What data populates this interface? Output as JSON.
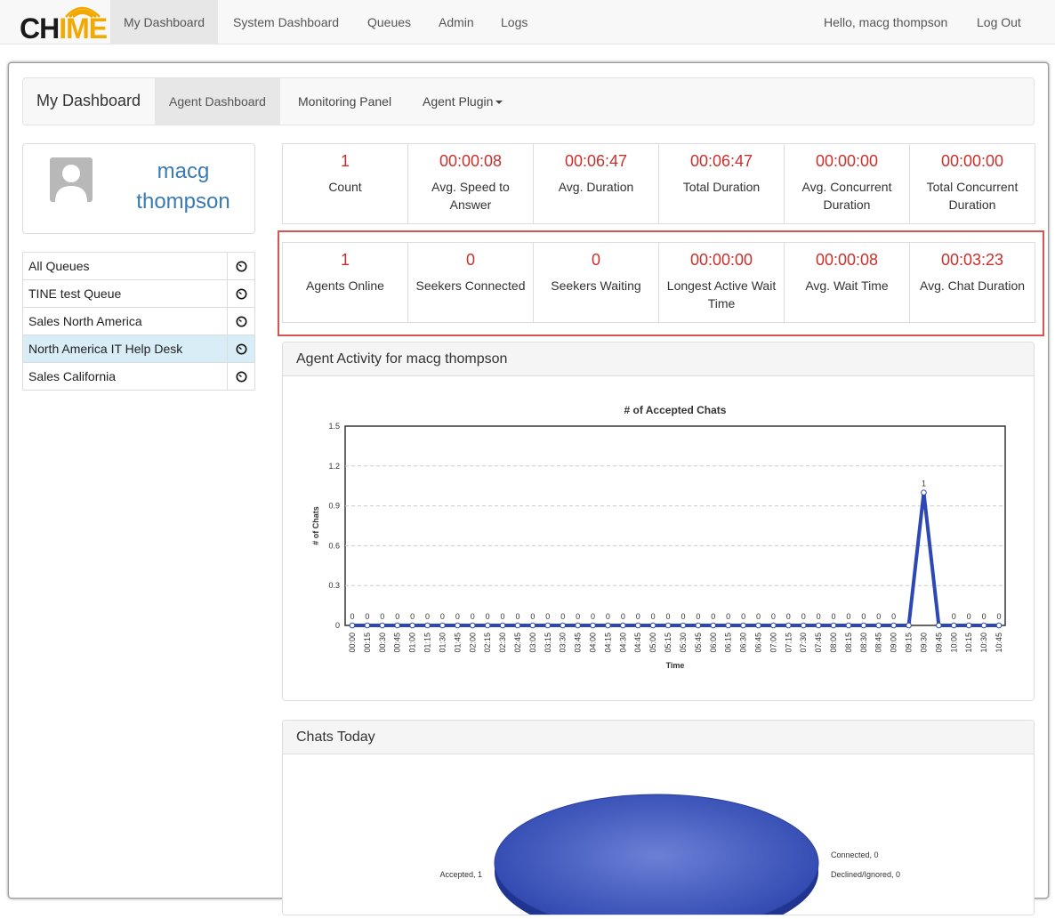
{
  "topnav": {
    "logo": {
      "dark": "CH",
      "accent": "ME",
      "i": "I"
    },
    "items": [
      "My Dashboard",
      "System Dashboard",
      "Queues",
      "Admin",
      "Logs"
    ],
    "greeting": "Hello, macg thompson",
    "logout": "Log Out"
  },
  "subnav": {
    "brand": "My Dashboard",
    "tabs": [
      "Agent Dashboard",
      "Monitoring Panel",
      "Agent Plugin"
    ]
  },
  "profile": {
    "name": "macg thompson"
  },
  "queues": [
    "All Queues",
    "TINE test Queue",
    "Sales North America",
    "North America IT Help Desk",
    "Sales California"
  ],
  "stats_row1": [
    {
      "value": "1",
      "label": "Count"
    },
    {
      "value": "00:00:08",
      "label": "Avg. Speed to Answer"
    },
    {
      "value": "00:06:47",
      "label": "Avg. Duration"
    },
    {
      "value": "00:06:47",
      "label": "Total Duration"
    },
    {
      "value": "00:00:00",
      "label": "Avg. Concurrent Duration"
    },
    {
      "value": "00:00:00",
      "label": "Total Concurrent Duration"
    }
  ],
  "stats_row2": [
    {
      "value": "1",
      "label": "Agents Online"
    },
    {
      "value": "0",
      "label": "Seekers Connected"
    },
    {
      "value": "0",
      "label": "Seekers Waiting"
    },
    {
      "value": "00:00:00",
      "label": "Longest Active Wait Time"
    },
    {
      "value": "00:00:08",
      "label": "Avg. Wait Time"
    },
    {
      "value": "00:03:23",
      "label": "Avg. Chat Duration"
    }
  ],
  "activity_panel": {
    "title": "Agent Activity for macg thompson"
  },
  "chats_panel": {
    "title": "Chats Today"
  },
  "chart_data": [
    {
      "type": "line",
      "title": "# of Accepted Chats",
      "xlabel": "Time",
      "ylabel": "# of Chats",
      "ylim": [
        0,
        1.5
      ],
      "yticks": [
        "0",
        "0.3",
        "0.6",
        "0.9",
        "1.2",
        "1.5"
      ],
      "grid": true,
      "color": "#2d48b5",
      "categories": [
        "00:00",
        "00:15",
        "00:30",
        "00:45",
        "01:00",
        "01:15",
        "01:30",
        "01:45",
        "02:00",
        "02:15",
        "02:30",
        "02:45",
        "03:00",
        "03:15",
        "03:30",
        "03:45",
        "04:00",
        "04:15",
        "04:30",
        "04:45",
        "05:00",
        "05:15",
        "05:30",
        "05:45",
        "06:00",
        "06:15",
        "06:30",
        "06:45",
        "07:00",
        "07:15",
        "07:30",
        "07:45",
        "08:00",
        "08:15",
        "08:30",
        "08:45",
        "09:00",
        "09:15",
        "09:30",
        "09:45",
        "10:00",
        "10:15",
        "10:30",
        "10:45"
      ],
      "values": [
        0,
        0,
        0,
        0,
        0,
        0,
        0,
        0,
        0,
        0,
        0,
        0,
        0,
        0,
        0,
        0,
        0,
        0,
        0,
        0,
        0,
        0,
        0,
        0,
        0,
        0,
        0,
        0,
        0,
        0,
        0,
        0,
        0,
        0,
        0,
        0,
        0,
        0,
        1,
        0,
        0,
        0,
        0,
        0
      ],
      "data_labels": [
        "0",
        "0",
        "0",
        "0",
        "0",
        "0",
        "0",
        "0",
        "0",
        "0",
        "0",
        "0",
        "0",
        "0",
        "0",
        "0",
        "0",
        "0",
        "0",
        "0",
        "0",
        "0",
        "0",
        "0",
        "0",
        "0",
        "0",
        "0",
        "0",
        "0",
        "0",
        "0",
        "0",
        "0",
        "0",
        "0",
        "0",
        "",
        "1",
        "",
        "0",
        "0",
        "0",
        "0"
      ]
    },
    {
      "type": "pie",
      "slices": [
        {
          "label": "Accepted, 1",
          "value": 1
        },
        {
          "label": "Connected, 0",
          "value": 0
        },
        {
          "label": "Declined/Ignored, 0",
          "value": 0
        }
      ],
      "color": "#3f57c0"
    }
  ]
}
